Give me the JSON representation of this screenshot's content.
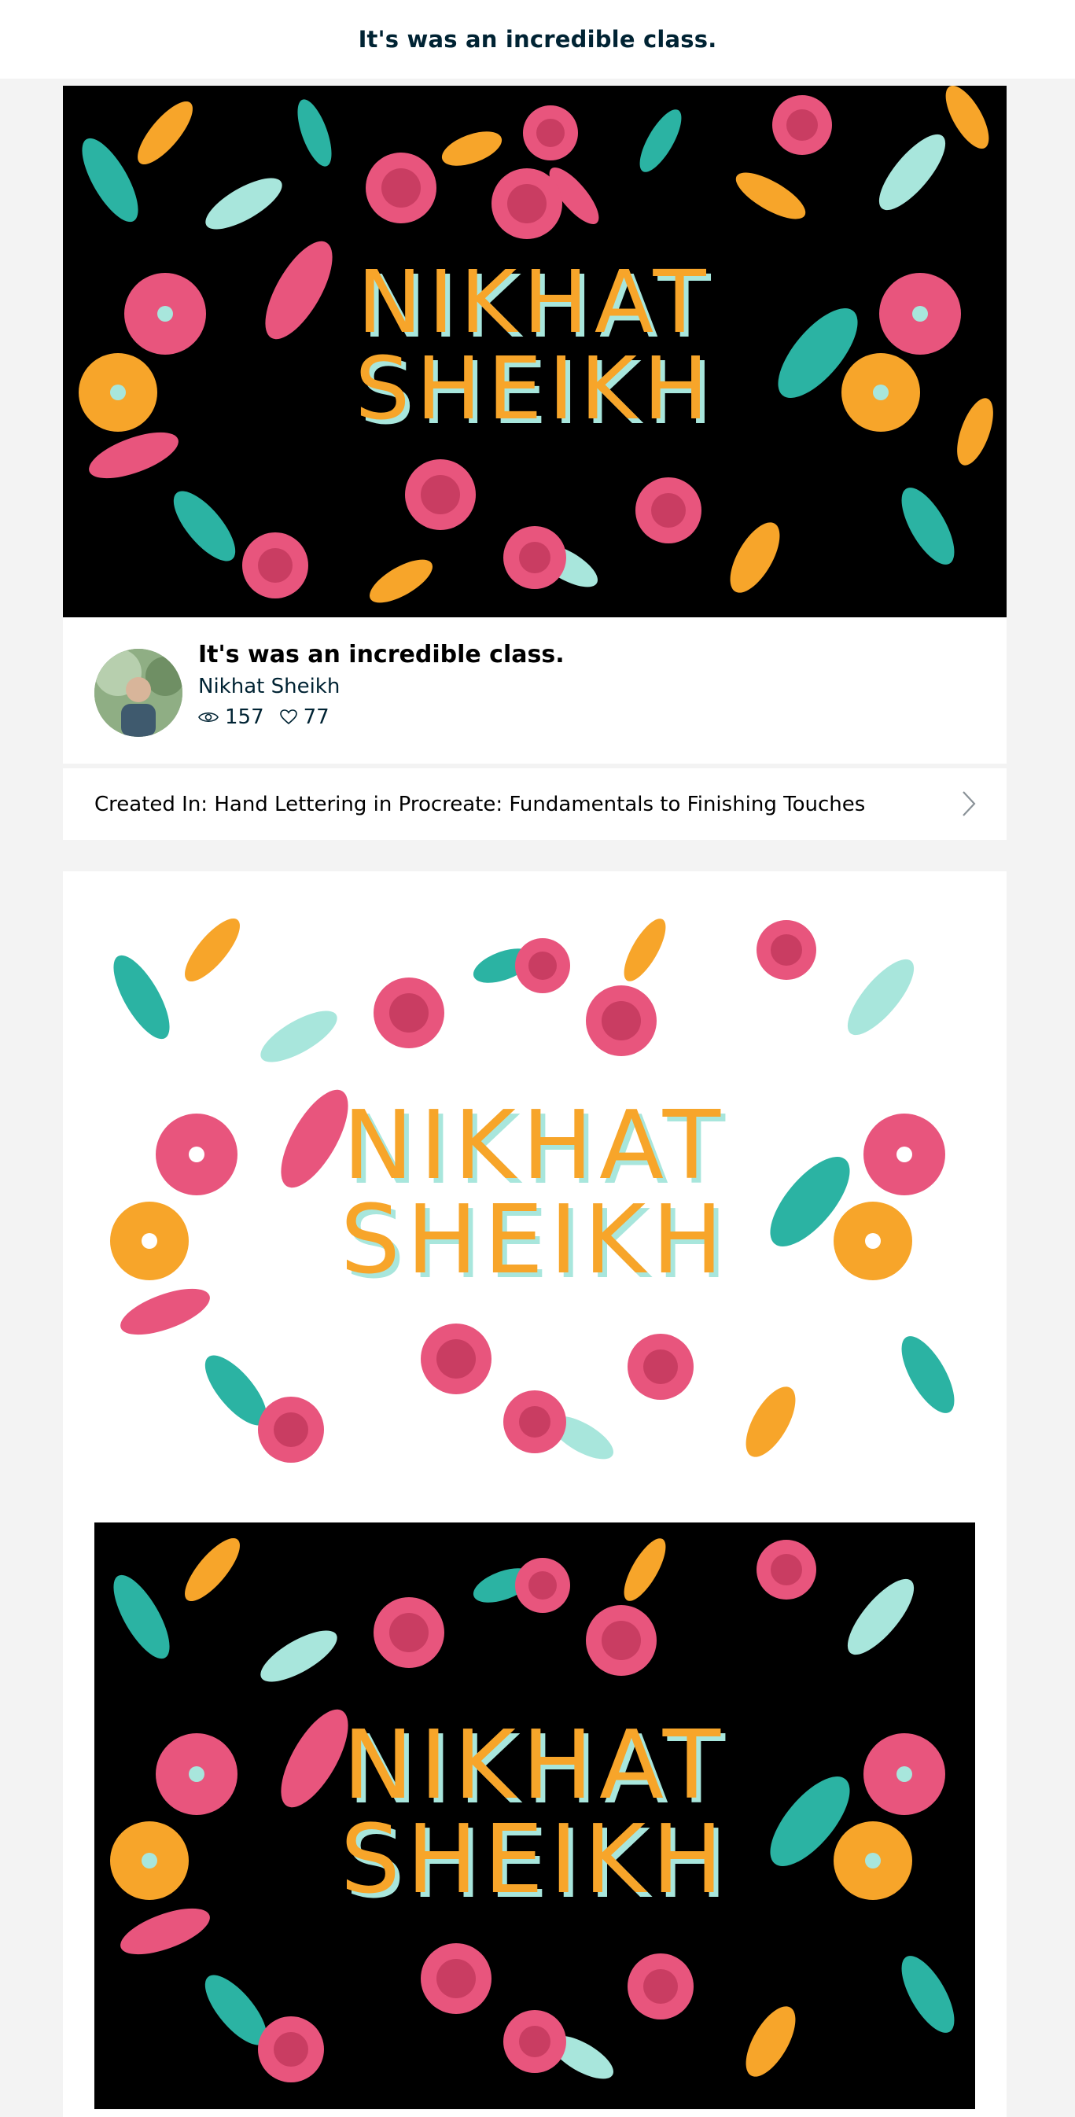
{
  "header": {
    "title": "It's was an incredible class."
  },
  "project": {
    "title": "It's was an incredible class.",
    "author": "Nikhat Sheikh",
    "views": "157",
    "likes": "77",
    "artwork_text": [
      "NIKHAT",
      "SHEIKH"
    ]
  },
  "created_in": {
    "label": "Created In: Hand Lettering in Procreate: Fundamentals to Finishing Touches"
  },
  "icons": {
    "views": "eye-icon",
    "likes": "heart-icon",
    "chevron": "chevron-right-icon"
  },
  "colors": {
    "pink": "#e8557d",
    "orange": "#f7a52a",
    "teal": "#2bb3a3",
    "mint": "#a8e6dc",
    "dark": "#000000",
    "text": "#002333"
  }
}
